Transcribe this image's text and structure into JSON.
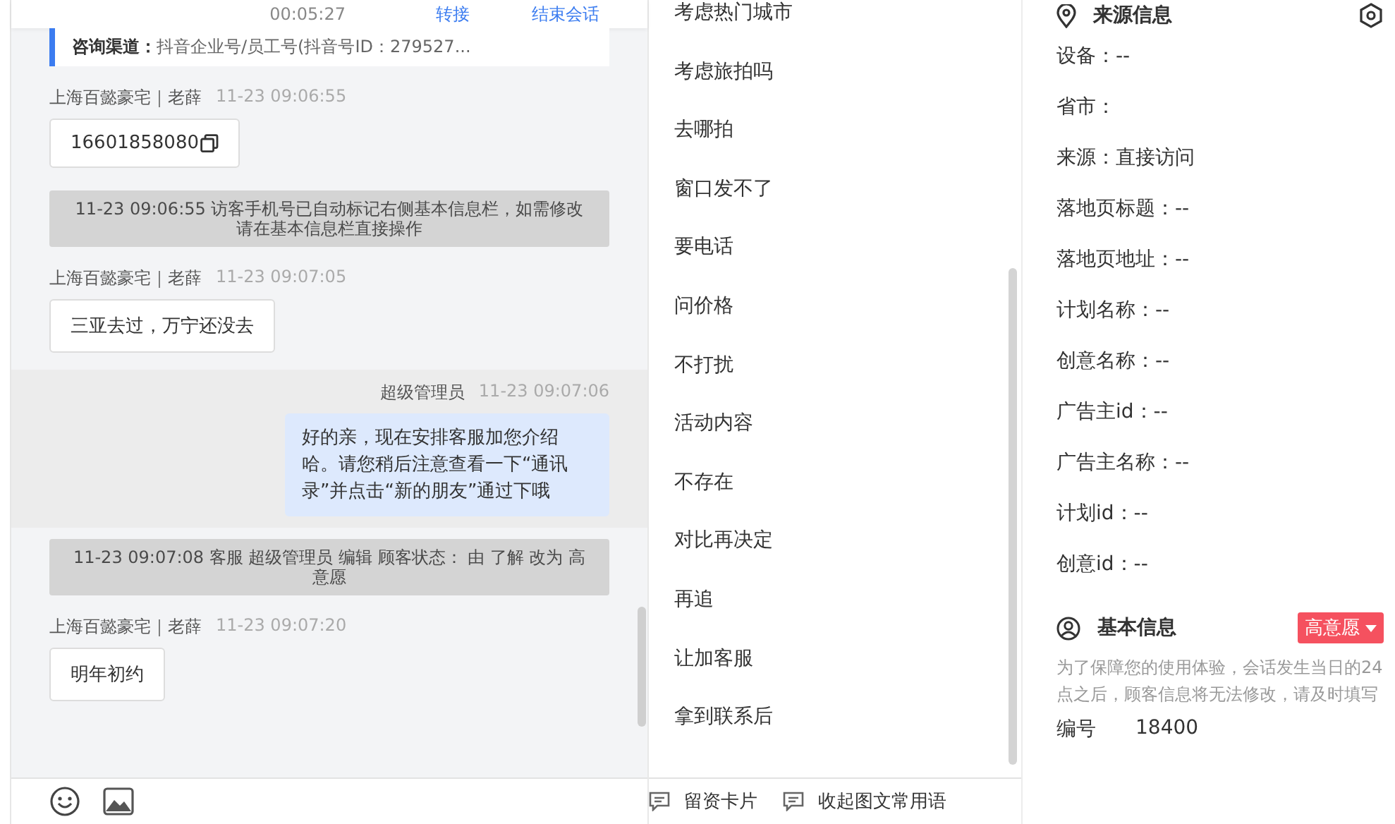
{
  "chat": {
    "header": {
      "duration": "00:05:27",
      "transfer": "转接",
      "end_session": "结束会话"
    },
    "channel": {
      "label": "咨询渠道：",
      "value": "抖音企业号/员工号(抖音号ID：279527..."
    },
    "messages": [
      {
        "kind": "customer",
        "sender": "上海百懿豪宅｜老薛",
        "time": "11-23 09:06:55",
        "text": "16601858080",
        "copyable": true
      },
      {
        "kind": "system",
        "text": "11-23 09:06:55 访客手机号已自动标记右侧基本信息栏，如需修改请在基本信息栏直接操作"
      },
      {
        "kind": "customer",
        "sender": "上海百懿豪宅｜老薛",
        "time": "11-23 09:07:05",
        "text": "三亚去过，万宁还没去",
        "copyable": false
      },
      {
        "kind": "agent",
        "sender": "超级管理员",
        "time": "11-23 09:07:06",
        "text": "好的亲，现在安排客服加您介绍哈。请您稍后注意查看一下“通讯录”并点击“新的朋友”通过下哦"
      },
      {
        "kind": "system",
        "text": "11-23 09:07:08 客服 超级管理员 编辑 顾客状态： 由 了解 改为 高意愿"
      },
      {
        "kind": "customer",
        "sender": "上海百懿豪宅｜老薛",
        "time": "11-23 09:07:20",
        "text": "明年初约",
        "copyable": false
      }
    ]
  },
  "quick_replies": {
    "items": [
      "考虑热门城市",
      "考虑旅拍吗",
      "去哪拍",
      "窗口发不了",
      "要电话",
      "问价格",
      "不打扰",
      "活动内容",
      "不存在",
      "对比再决定",
      "再追",
      "让加客服",
      "拿到联系后"
    ],
    "footer": [
      "留资卡片",
      "收起图文常用语"
    ]
  },
  "source_info": {
    "title": "来源信息",
    "fields": [
      "设备：--",
      "省市：",
      "来源：直接访问",
      "落地页标题：--",
      "落地页地址：--",
      "计划名称：--",
      "创意名称：--",
      "广告主id：--",
      "广告主名称：--",
      "计划id：--",
      "创意id：--"
    ]
  },
  "basic_info": {
    "title": "基本信息",
    "status": "高意愿",
    "note": "为了保障您的使用体验，会话发生当日的24点之后，顾客信息将无法修改，请及时填写",
    "fields": [
      {
        "label": "编号",
        "value": "18400"
      }
    ]
  }
}
